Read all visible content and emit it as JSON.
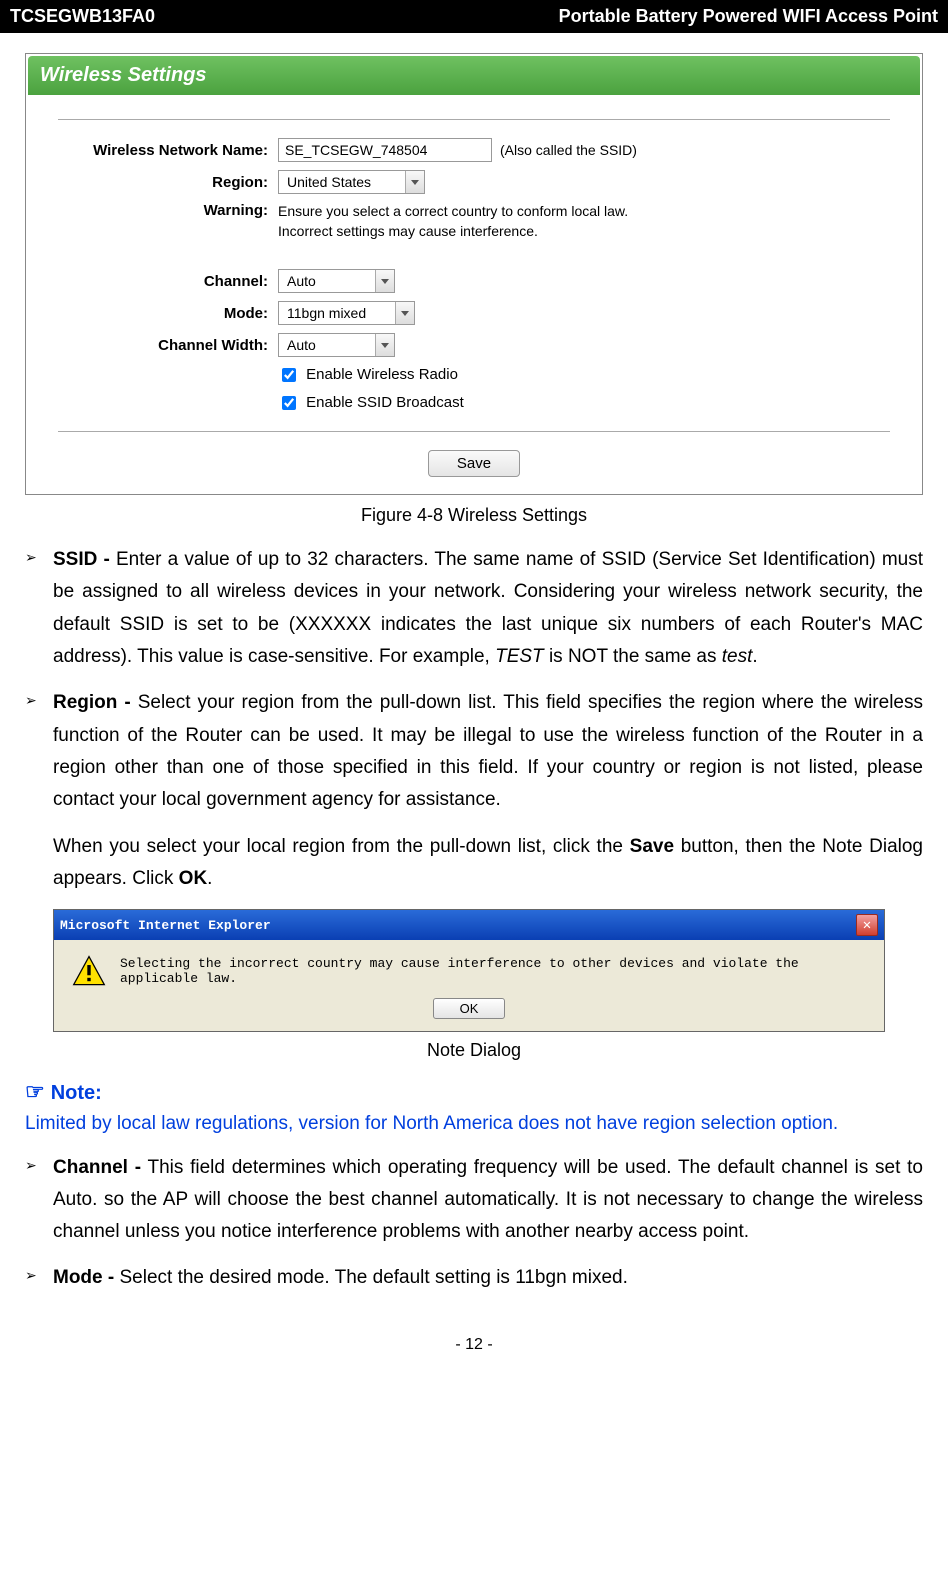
{
  "header": {
    "left": "TCSEGWB13FA0",
    "right": "Portable Battery Powered WIFI Access Point"
  },
  "panel": {
    "title": "Wireless Settings",
    "rows": {
      "ssid_label": "Wireless Network Name:",
      "ssid_value": "SE_TCSEGW_748504",
      "ssid_note": "(Also called the SSID)",
      "region_label": "Region:",
      "region_value": "United States",
      "warning_label": "Warning:",
      "warning_text": "Ensure you select a correct country to conform local law. Incorrect settings may cause interference.",
      "channel_label": "Channel:",
      "channel_value": "Auto",
      "mode_label": "Mode:",
      "mode_value": "11bgn mixed",
      "cwidth_label": "Channel Width:",
      "cwidth_value": "Auto",
      "chk_radio": "Enable Wireless Radio",
      "chk_ssid": "Enable SSID Broadcast",
      "save": "Save"
    }
  },
  "caption1": "Figure 4-8 Wireless Settings",
  "bullets": {
    "ssid_title": "SSID -",
    "ssid_body": " Enter a value of up to 32 characters. The same name of SSID (Service Set Identification) must be assigned to all wireless devices in your network. Considering your wireless network security, the default SSID is set to be   (XXXXXX indicates the last unique six numbers of each Router's MAC address). This value is case-sensitive. For example, ",
    "ssid_test1": "TEST",
    "ssid_mid": " is NOT the same as ",
    "ssid_test2": "test",
    "ssid_end": ".",
    "region_title": "Region -",
    "region_body": " Select your region from the pull-down list. This field specifies the region where the wireless function of the Router can be used. It may be illegal to use the wireless function of the Router in a region other than one of those specified in this field. If your country or region is not listed, please contact your local government agency for assistance.",
    "region_para2a": "When you select your local region from the pull-down list, click the ",
    "region_para2_save": "Save",
    "region_para2b": " button, then the Note Dialog appears. Click ",
    "region_para2_ok": "OK",
    "region_para2c": ".",
    "channel_title": "Channel -",
    "channel_body": " This field determines which operating frequency will be used. The default channel is set to Auto. so the AP will choose the best channel automatically. It is not necessary to change the wireless channel unless you notice interference problems with another nearby access point.",
    "mode_title": "Mode -",
    "mode_body": " Select the desired mode. The default setting is 11bgn mixed."
  },
  "dialog": {
    "title": "Microsoft Internet Explorer",
    "msg": "Selecting the incorrect country may cause interference to other devices and violate the applicable law.",
    "ok": "OK"
  },
  "caption2": "Note Dialog",
  "note": {
    "heading": "Note:",
    "body": "Limited by local law regulations, version for North America does not have region selection option."
  },
  "pagenum": "- 12 -"
}
